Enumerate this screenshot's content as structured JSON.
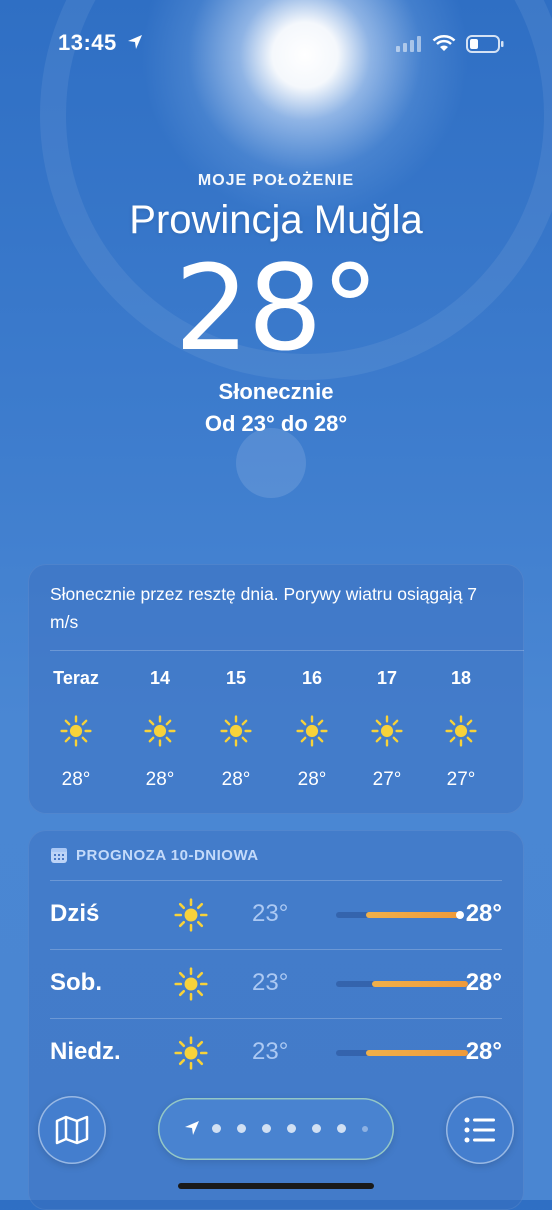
{
  "status_bar": {
    "time": "13:45"
  },
  "header": {
    "location_label": "MOJE POŁOŻENIE",
    "city": "Prowincja Muğla",
    "temperature": "28°",
    "condition": "Słonecznie",
    "range": "Od 23° do 28°"
  },
  "hourly": {
    "summary": "Słonecznie przez resztę dnia. Porywy wiatru osiągają 7 m/s",
    "hours": [
      {
        "label": "Teraz",
        "icon": "sun-icon",
        "temp": "28°"
      },
      {
        "label": "14",
        "icon": "sun-icon",
        "temp": "28°"
      },
      {
        "label": "15",
        "icon": "sun-icon",
        "temp": "28°"
      },
      {
        "label": "16",
        "icon": "sun-icon",
        "temp": "28°"
      },
      {
        "label": "17",
        "icon": "sun-icon",
        "temp": "27°"
      },
      {
        "label": "18",
        "icon": "sun-icon",
        "temp": "27°"
      }
    ]
  },
  "forecast": {
    "title": "PROGNOZA 10-DNIOWA",
    "days": [
      {
        "name": "Dziś",
        "icon": "sun-icon",
        "low": "23°",
        "high": "28°",
        "current_marker": true
      },
      {
        "name": "Sob.",
        "icon": "sun-icon",
        "low": "23°",
        "high": "28°"
      },
      {
        "name": "Niedz.",
        "icon": "sun-icon",
        "low": "23°",
        "high": "28°"
      }
    ]
  },
  "toolbar": {
    "map_icon": "map-icon",
    "list_icon": "list-icon",
    "page_dots": 7
  },
  "colors": {
    "background": "#3d7ccd",
    "sun_icon": "#f7d23a",
    "temp_bar": "#ef9a3a"
  }
}
